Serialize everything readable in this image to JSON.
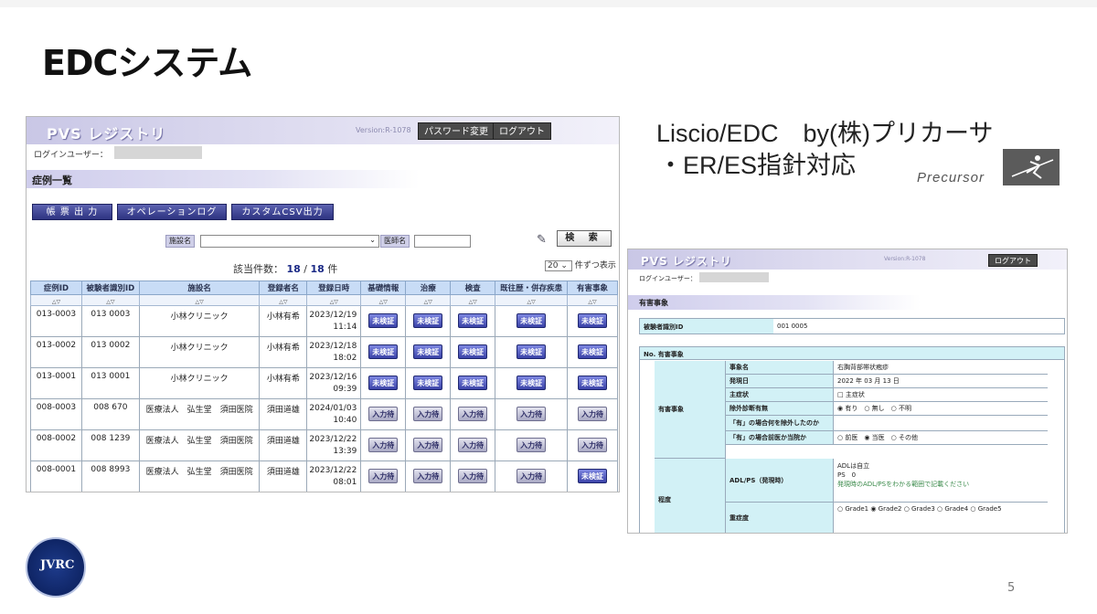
{
  "slide": {
    "title": "EDCシステム",
    "page_number": "5"
  },
  "vendor": {
    "line1": "Liscio/EDC　by(株)プリカーサ",
    "line2": "・ER/ES指針対応",
    "logo_text": "Precursor"
  },
  "list_screen": {
    "app_title": "PVS レジストリ",
    "version": "Version:R-1078",
    "password_btn": "パスワード変更",
    "logout_btn": "ログアウト",
    "login_label": "ログインユーザー：",
    "section": "症例一覧",
    "actions": [
      "帳 票 出 力",
      "オペレーションログ",
      "カスタムCSV出力"
    ],
    "filter_facility_label": "施設名",
    "filter_doctor_label": "医師名",
    "search_btn": "検 索",
    "count_label": "該当件数：",
    "count_shown": "18",
    "count_total": "18",
    "count_unit": "件",
    "perpage_value": "20",
    "perpage_label": "件ずつ表示",
    "columns": [
      "症例ID",
      "被験者識別ID",
      "施設名",
      "登録者名",
      "登録日時",
      "基礎情報",
      "治療",
      "検査",
      "既往歴・併存疾患",
      "有害事象"
    ],
    "rows": [
      {
        "id": "013-0003",
        "subject": "013 0003",
        "facility": "小林クリニック",
        "registrant": "小林有希",
        "date": "2023/12/19",
        "time": "11:14",
        "badges": [
          "未検証",
          "未検証",
          "未検証",
          "未検証",
          "未検証"
        ]
      },
      {
        "id": "013-0002",
        "subject": "013 0002",
        "facility": "小林クリニック",
        "registrant": "小林有希",
        "date": "2023/12/18",
        "time": "18:02",
        "badges": [
          "未検証",
          "未検証",
          "未検証",
          "未検証",
          "未検証"
        ]
      },
      {
        "id": "013-0001",
        "subject": "013 0001",
        "facility": "小林クリニック",
        "registrant": "小林有希",
        "date": "2023/12/16",
        "time": "09:39",
        "badges": [
          "未検証",
          "未検証",
          "未検証",
          "未検証",
          "未検証"
        ]
      },
      {
        "id": "008-0003",
        "subject": "008 670",
        "facility": "医療法人　弘生堂　須田医院",
        "registrant": "須田道雄",
        "date": "2024/01/03",
        "time": "10:40",
        "badges": [
          "入力待",
          "入力待",
          "入力待",
          "入力待",
          "入力待"
        ]
      },
      {
        "id": "008-0002",
        "subject": "008 1239",
        "facility": "医療法人　弘生堂　須田医院",
        "registrant": "須田道雄",
        "date": "2023/12/22",
        "time": "13:39",
        "badges": [
          "入力待",
          "入力待",
          "入力待",
          "入力待",
          "入力待"
        ]
      },
      {
        "id": "008-0001",
        "subject": "008 8993",
        "facility": "医療法人　弘生堂　須田医院",
        "registrant": "須田道雄",
        "date": "2023/12/22",
        "time": "08:01",
        "badges": [
          "入力待",
          "入力待",
          "入力待",
          "入力待",
          "未検証"
        ]
      }
    ]
  },
  "detail_screen": {
    "app_title": "PVS レジストリ",
    "version": "Version:R-1078",
    "logout_btn": "ログアウト",
    "login_label": "ログインユーザー：",
    "section": "有害事象",
    "subject_label": "被験者識別ID",
    "subject_value": "001 0005",
    "table_header": "No. 有害事象",
    "category_ae": "有害事象",
    "category_severity": "程度",
    "fields": [
      {
        "label": "事象名",
        "value": "右胸背部帯状疱疹"
      },
      {
        "label": "発現日",
        "value": "2022 年 03 月 13 日"
      },
      {
        "label": "主症状",
        "value": "□ 主症状"
      },
      {
        "label": "除外診断有無",
        "value": "◉ 有り　○ 無し　○ 不明"
      },
      {
        "label": "「有」の場合何を除外したのか",
        "value": ""
      },
      {
        "label": "「有」の場合前医か当院か",
        "value": "○ 前医　◉ 当医　○ その他"
      }
    ],
    "adl_label": "ADL/PS（発現時）",
    "adl_line1": "ADLは自立",
    "adl_line2": "PS　0",
    "adl_hint": "発現時のADL/PSをわかる範囲で記載ください",
    "grade_label": "重症度",
    "grade_value": "○ Grade1 ◉ Grade2 ○ Grade3 ○ Grade4 ○ Grade5"
  },
  "footer": {
    "logo_text": "JVRC"
  }
}
